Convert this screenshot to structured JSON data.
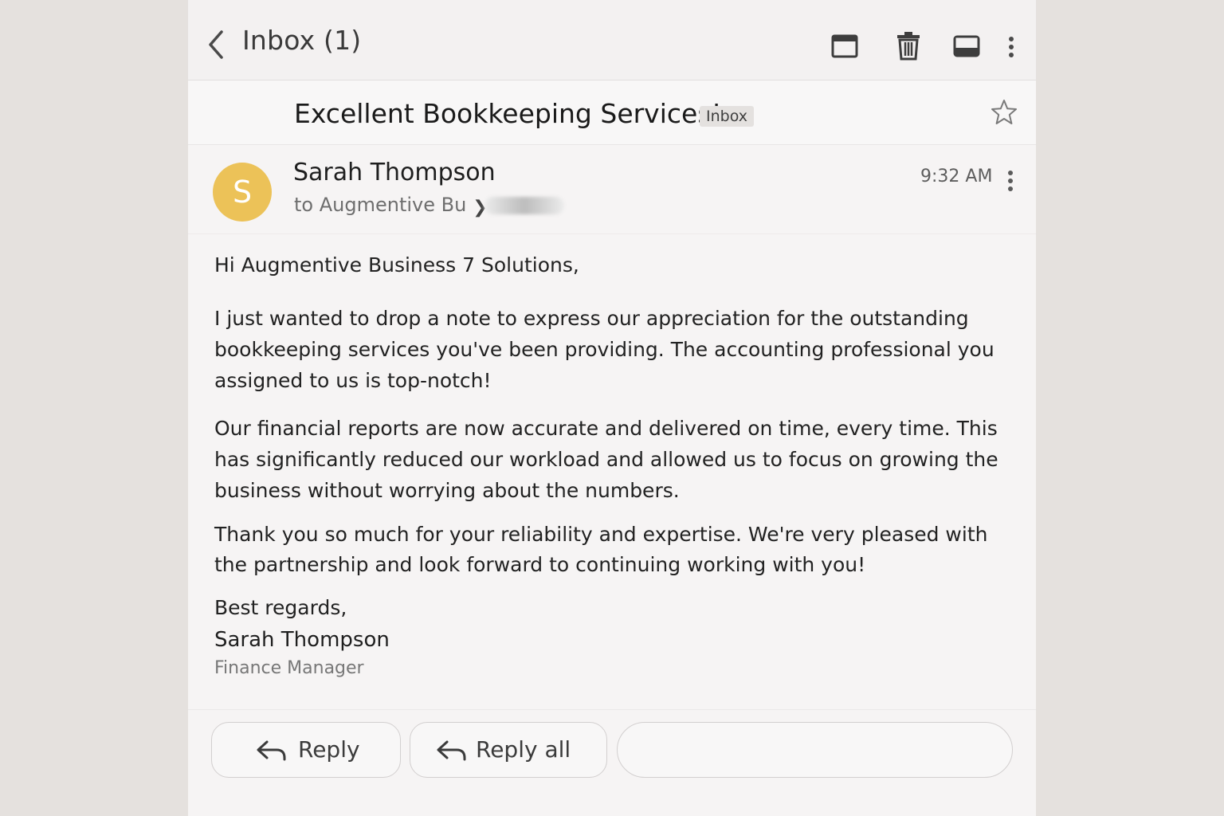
{
  "header": {
    "title": "Inbox (1)",
    "icons": [
      "back-arrow-icon",
      "archive-icon",
      "trash-icon",
      "mark-unread-icon",
      "more-vert-icon"
    ]
  },
  "email": {
    "subject": "Excellent Bookkeeping Services!",
    "label": "Inbox",
    "starred": false,
    "sender": {
      "initial": "S",
      "name": "Sarah Thompson",
      "avatar_color": "#ecc258"
    },
    "recipients_text": "to Augmentive Bu",
    "time": "9:32 AM",
    "body": {
      "greeting": "Hi Augmentive Business 7 Solutions,",
      "paragraph1": "I just wanted to drop a note to express our appreciation for the outstanding bookkeeping services you've been providing. The accounting professional you assigned to us is top-notch!",
      "paragraph2": "Our financial reports are now accurate and delivered on time, every time. This has significantly reduced our workload and allowed us to focus on growing the business without worrying about the numbers.",
      "paragraph3": "Thank you so much for your reliability and expertise. We're very pleased with the partnership and look forward to continuing working with you!",
      "closing": "Best regards,",
      "signature_name": "Sarah Thompson",
      "signature_title": "Finance Manager"
    }
  },
  "actions": {
    "reply_label": "Reply",
    "reply_all_label": "Reply all"
  }
}
